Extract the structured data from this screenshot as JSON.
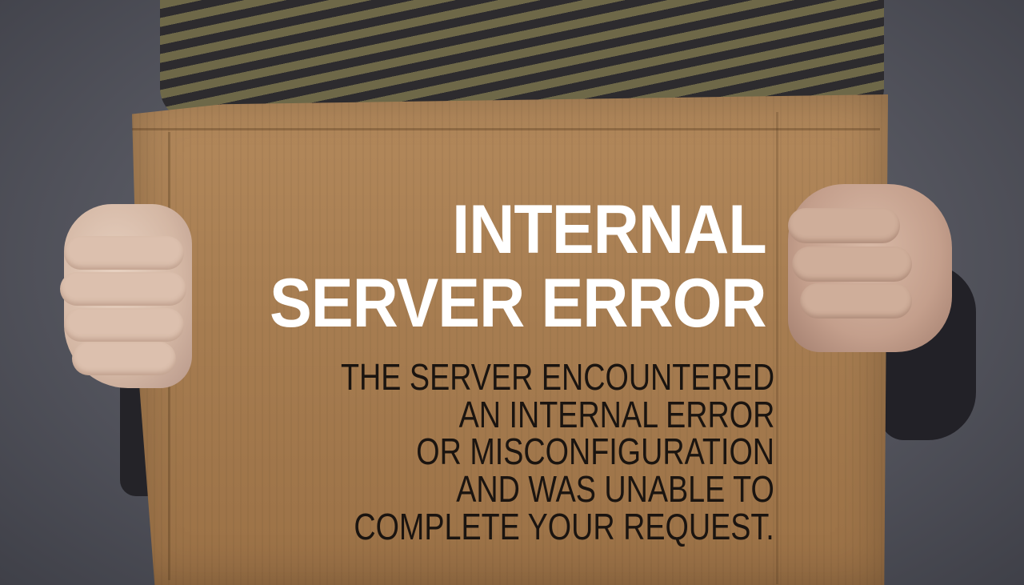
{
  "photo": {
    "heading": [
      "INTERNAL",
      "SERVER ERROR"
    ],
    "message_lines": [
      "THE SERVER ENCOUNTERED",
      "AN INTERNAL ERROR",
      "OR MISCONFIGURATION",
      "AND WAS UNABLE TO",
      "COMPLETE YOUR REQUEST."
    ]
  },
  "colors": {
    "background": "#55565f",
    "cardboard": "#a87e52",
    "heading_text": "#ffffff",
    "message_text": "#1a1410"
  }
}
